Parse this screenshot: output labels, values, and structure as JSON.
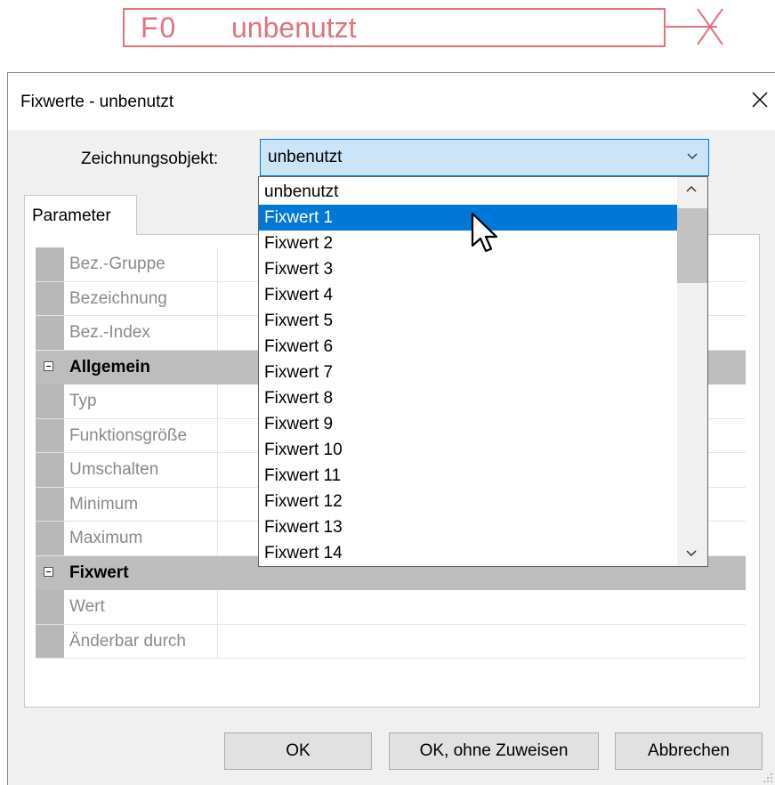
{
  "drawing_object": {
    "id": "F0",
    "label": "unbenutzt",
    "color": "#e0747a"
  },
  "dialog": {
    "title": "Fixwerte - unbenutzt",
    "close_icon": "close-icon"
  },
  "combo": {
    "label": "Zeichnungsobjekt:",
    "value": "unbenutzt"
  },
  "tabs": [
    {
      "label": "Parameter"
    }
  ],
  "property_grid": {
    "rows_top": [
      "Bez.-Gruppe",
      "Bezeichnung",
      "Bez.-Index"
    ],
    "categories": [
      {
        "label": "Allgemein",
        "rows": [
          "Typ",
          "Funktionsgröße",
          "Umschalten",
          "Minimum",
          "Maximum"
        ]
      },
      {
        "label": "Fixwert",
        "rows": [
          "Wert",
          "Änderbar durch"
        ]
      }
    ]
  },
  "dropdown": {
    "selected_index": 1,
    "items": [
      "unbenutzt",
      "Fixwert 1",
      "Fixwert 2",
      "Fixwert 3",
      "Fixwert 4",
      "Fixwert 5",
      "Fixwert 6",
      "Fixwert 7",
      "Fixwert 8",
      "Fixwert 9",
      "Fixwert 10",
      "Fixwert 11",
      "Fixwert 12",
      "Fixwert 13",
      "Fixwert 14"
    ]
  },
  "buttons": {
    "ok": "OK",
    "ok_no_assign": "OK, ohne Zuweisen",
    "cancel": "Abbrechen"
  },
  "colors": {
    "accent": "#0078d7",
    "combo_bg": "#cce4f7",
    "category_bg": "#bdbdbd"
  }
}
